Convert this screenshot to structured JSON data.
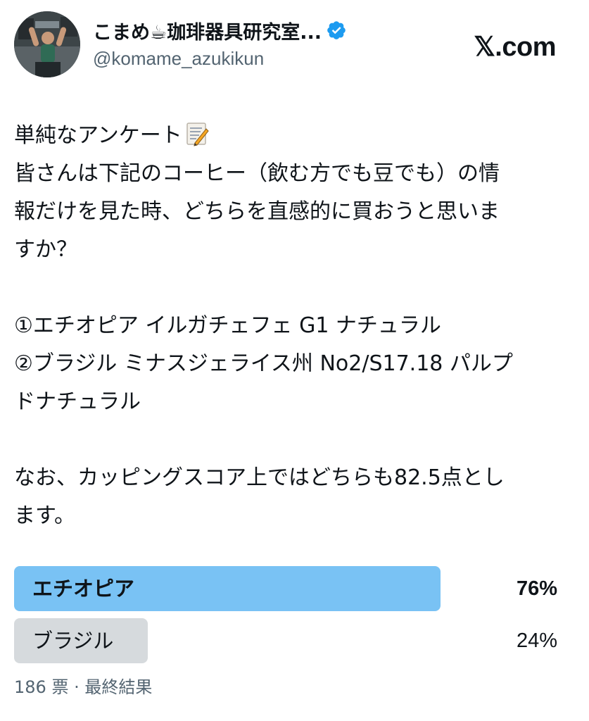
{
  "header": {
    "display_name": "こまめ☕珈琲器具研究室...",
    "handle": "@komame_azukikun",
    "brand": "𝕏.com"
  },
  "post": {
    "line1": "単純なアンケート",
    "line2": "皆さんは下記のコーヒー（飲む方でも豆でも）の情",
    "line3": "報だけを見た時、どちらを直感的に買おうと思いま",
    "line4": "すか？",
    "option1_text": "①エチオピア イルガチェフェ G1 ナチュラル",
    "option2_text_a": "②ブラジル ミナスジェライス州 No2/S17.18 パルプ",
    "option2_text_b": "ドナチュラル",
    "note_a": "なお、カッピングスコア上ではどちらも82.5点とし",
    "note_b": "ます。"
  },
  "poll": {
    "options": [
      {
        "label": "エチオピア",
        "percent_text": "76%",
        "share": 0.76,
        "winner": true
      },
      {
        "label": "ブラジル",
        "percent_text": "24%",
        "share": 0.24,
        "winner": false
      }
    ],
    "votes": "186 票",
    "separator": " · ",
    "status": "最終結果"
  },
  "colors": {
    "winner_bar": "#79c2f4",
    "other_bar": "#d6dadd",
    "verified_badge": "#1d9bf0",
    "secondary_text": "#536471"
  },
  "icons": {
    "verified": "verified-badge-icon",
    "memo": "memo-icon"
  }
}
